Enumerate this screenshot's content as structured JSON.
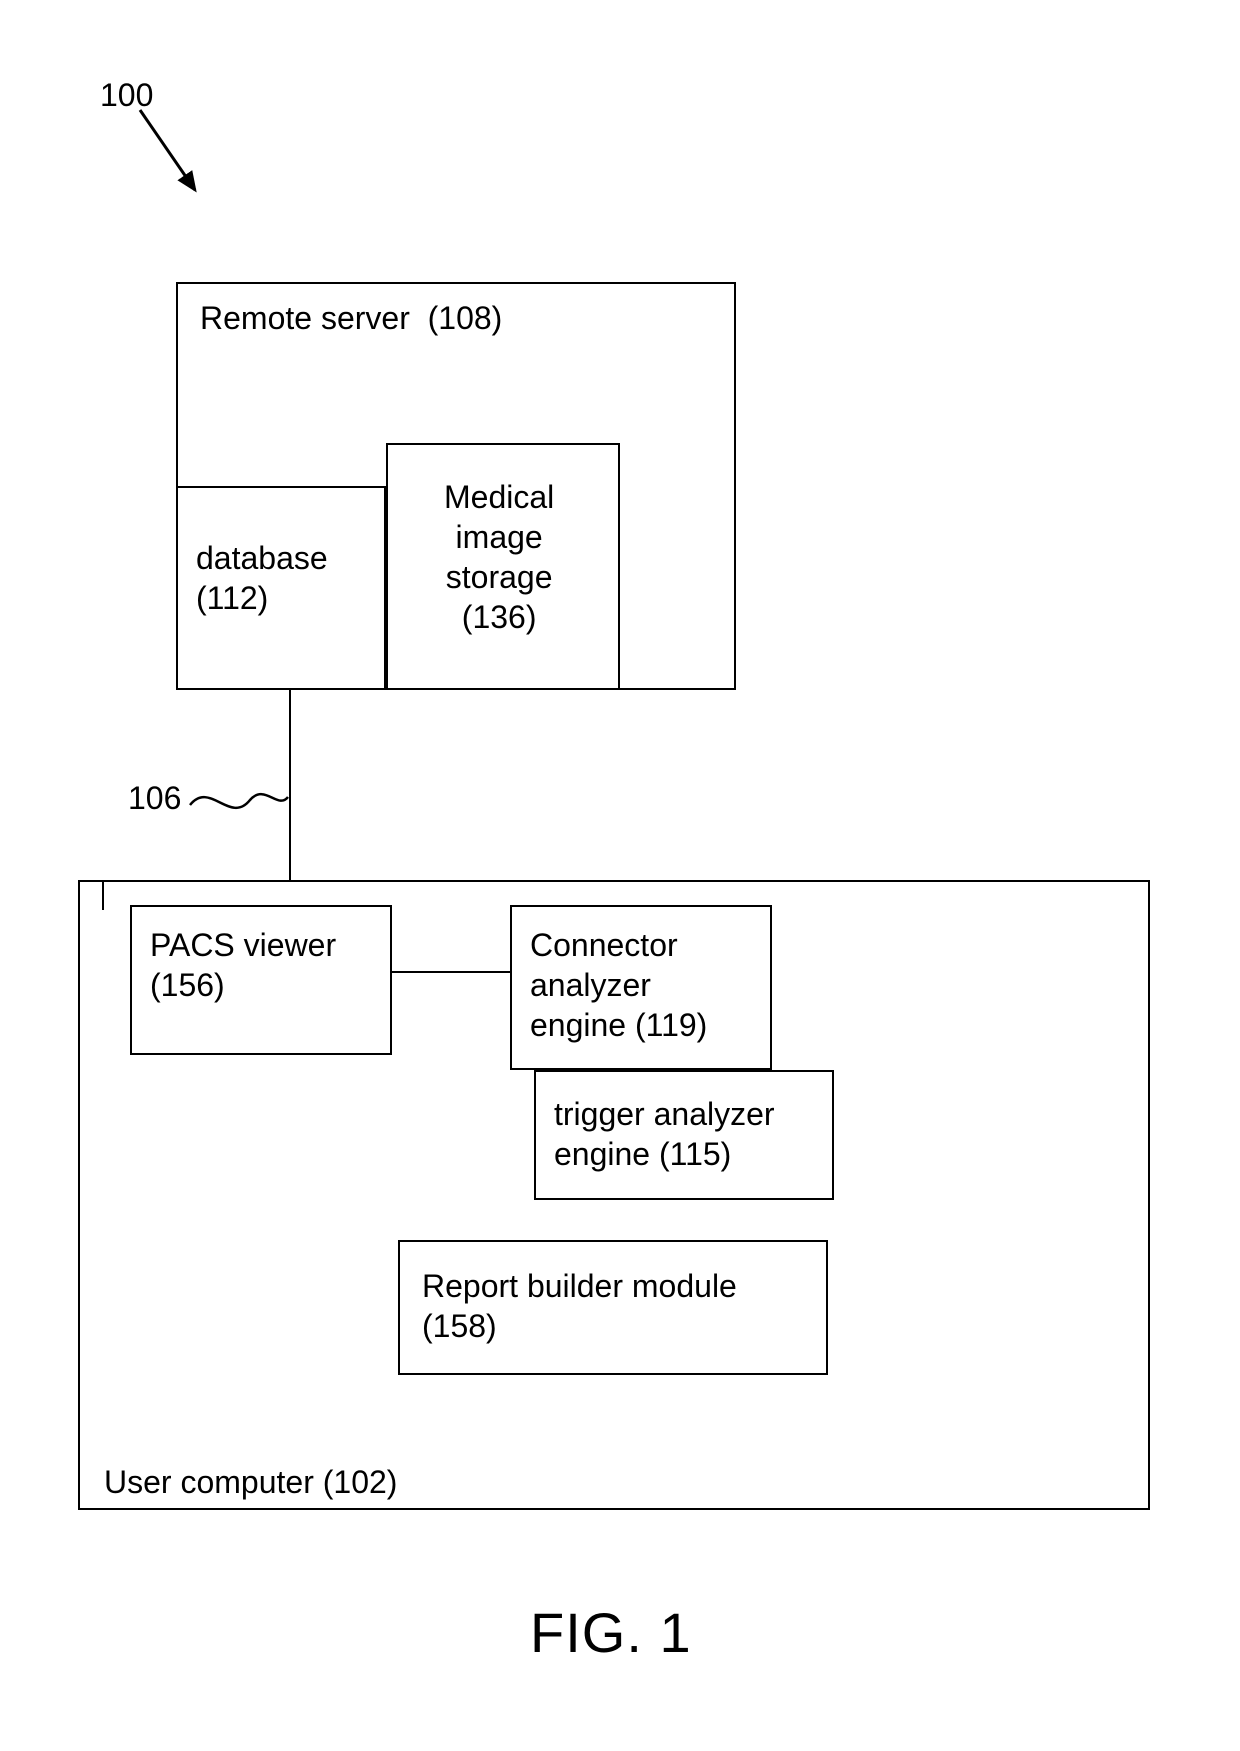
{
  "figure_ref_label": "100",
  "figure_caption": "FIG. 1",
  "connection_label": "106",
  "remote_server": {
    "title": "Remote server  (108)",
    "database": "database\n(112)",
    "storage": "Medical\nimage\nstorage\n(136)"
  },
  "user_computer": {
    "title": "User computer (102)",
    "pacs_viewer": "PACS viewer\n(156)",
    "connector_engine": "Connector\nanalyzer\nengine (119)",
    "trigger_engine": "trigger analyzer\nengine (115)",
    "report_builder": "Report builder module\n(158)"
  }
}
